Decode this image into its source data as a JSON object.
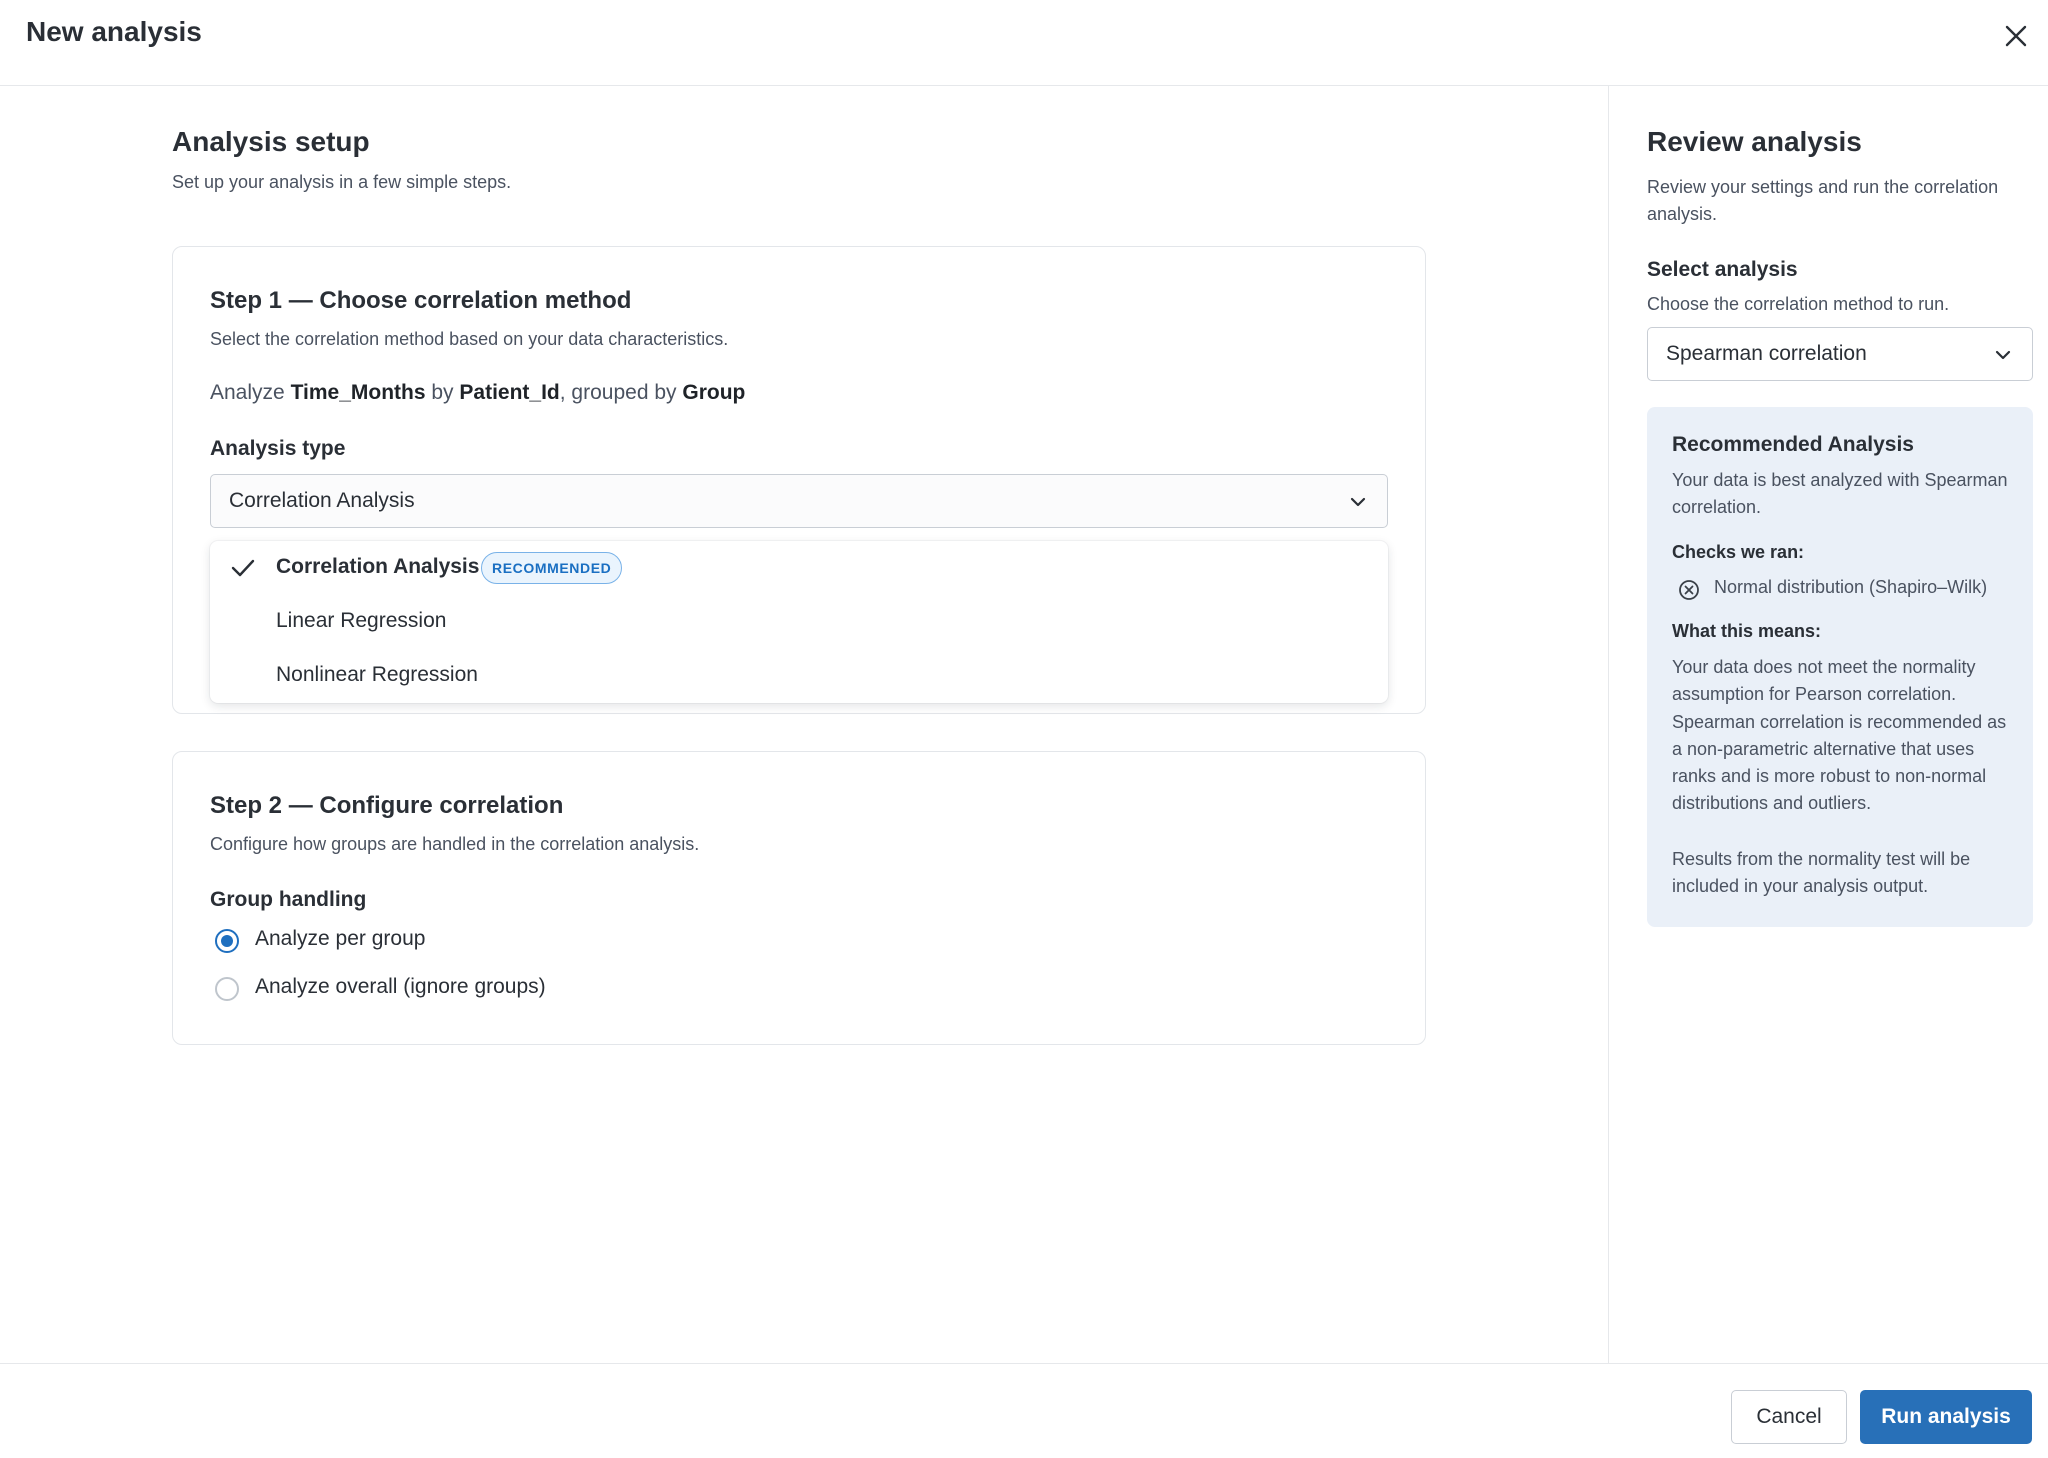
{
  "header": {
    "title": "New analysis"
  },
  "setup": {
    "title": "Analysis setup",
    "subtitle": "Set up your analysis in a few simple steps."
  },
  "step1": {
    "title": "Step 1 — Choose correlation method",
    "subtitle": "Select the correlation method based on your data characteristics.",
    "analyze": {
      "prefix": "Analyze",
      "variable": "Time_Months",
      "by_word": "by",
      "by_variable": "Patient_Id",
      "grouped_word": ", grouped by",
      "group_variable": "Group"
    },
    "analysis_type_label": "Analysis type",
    "analysis_type_value": "Correlation Analysis",
    "options": [
      {
        "label": "Correlation Analysis",
        "selected": true,
        "badge": "RECOMMENDED"
      },
      {
        "label": "Linear Regression",
        "selected": false
      },
      {
        "label": "Nonlinear Regression",
        "selected": false
      }
    ]
  },
  "step2": {
    "title": "Step 2 — Configure correlation",
    "subtitle": "Configure how groups are handled in the correlation analysis.",
    "group_handling_label": "Group handling",
    "radios": [
      {
        "label": "Analyze per group",
        "checked": true
      },
      {
        "label": "Analyze overall (ignore groups)",
        "checked": false
      }
    ]
  },
  "review": {
    "title": "Review analysis",
    "subtitle": "Review your settings and run the correlation analysis.",
    "select_label": "Select analysis",
    "select_sub": "Choose the correlation method to run.",
    "select_value": "Spearman correlation",
    "recommended": {
      "title": "Recommended Analysis",
      "description": "Your data is best analyzed with Spearman correlation.",
      "checks_heading": "Checks we ran:",
      "checks": [
        {
          "label": "Normal distribution (Shapiro–Wilk)",
          "icon": "x-circle-icon"
        }
      ],
      "means_heading": "What this means:",
      "means_text": "Your data does not meet the normality assumption for Pearson correlation. Spearman correlation is recommended as a non-parametric alternative that uses ranks and is more robust to non-normal distributions and outliers.",
      "note": "Results from the normality test will be included in your analysis output."
    }
  },
  "footer": {
    "cancel_label": "Cancel",
    "run_label": "Run analysis"
  },
  "colors": {
    "primary": "#2870b8",
    "badge_text": "#1a6fc2",
    "badge_bg": "#eaf4fd",
    "info_bg": "#eaf0f8"
  }
}
